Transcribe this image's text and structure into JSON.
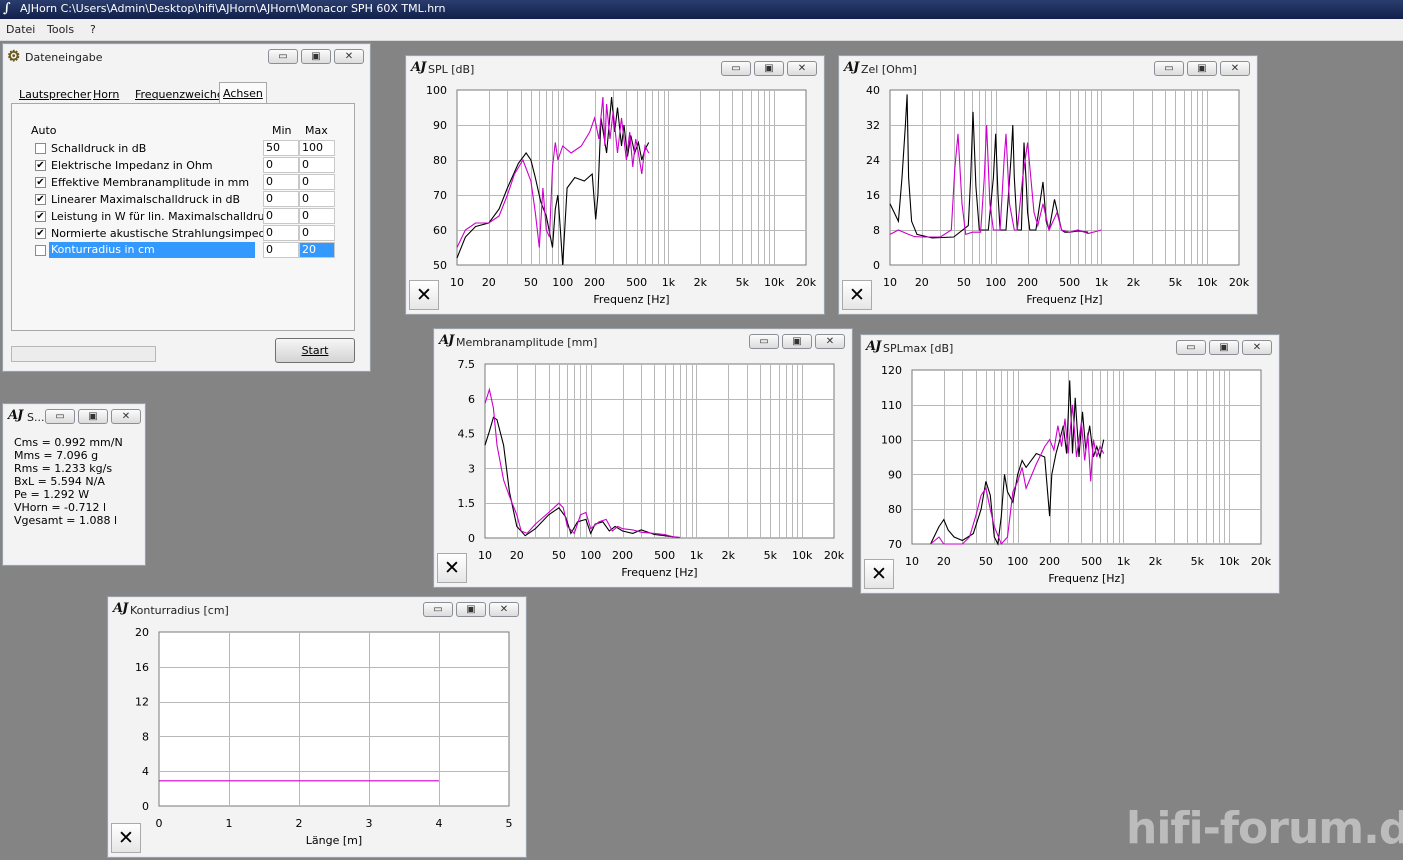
{
  "app": {
    "title": "AJHorn  C:\\Users\\Admin\\Desktop\\hifi\\AJHorn\\AJHorn\\Monacor SPH 60X TML.hrn"
  },
  "menu": [
    "Datei",
    "Tools",
    "?"
  ],
  "window_buttons": {
    "minimize": "▭",
    "restore": "▣",
    "close": "✕"
  },
  "x_button": "✕",
  "logo": "AJ",
  "data_input": {
    "title": "Dateneingabe",
    "tabs": [
      "Lautsprecher",
      "Horn",
      "Frequenzweiche",
      "Achsen"
    ],
    "active_tab": "Achsen",
    "headers": {
      "auto": "Auto",
      "min": "Min",
      "max": "Max"
    },
    "rows": [
      {
        "label": "Schalldruck in dB",
        "checked": false,
        "min": "50",
        "max": "100"
      },
      {
        "label": "Elektrische Impedanz in Ohm",
        "checked": true,
        "min": "0",
        "max": "0"
      },
      {
        "label": "Effektive Membranamplitude in mm",
        "checked": true,
        "min": "0",
        "max": "0"
      },
      {
        "label": "Linearer Maximalschalldruck in dB",
        "checked": true,
        "min": "0",
        "max": "0"
      },
      {
        "label": "Leistung in W für lin. Maximalschalldruck",
        "checked": true,
        "min": "0",
        "max": "0"
      },
      {
        "label": "Normierte akustische Strahlungsimpedanz",
        "checked": true,
        "min": "0",
        "max": "0"
      },
      {
        "label": "Konturradius in cm",
        "checked": false,
        "min": "0",
        "max": "20"
      }
    ],
    "start_label": "Start"
  },
  "params": {
    "title": "S...",
    "lines": [
      "Cms = 0.992 mm/N",
      "Mms = 7.096 g",
      "Rms = 1.233 kg/s",
      "BxL = 5.594 N/A",
      "Pe = 1.292 W",
      "VHorn = -0.712 l",
      "Vgesamt = 1.088 l"
    ]
  },
  "watermark": "hifi-forum.de",
  "colors": {
    "series_black": "#000000",
    "series_magenta": "#cc00cc",
    "desktop": "#848484",
    "selection": "#3399ff"
  },
  "chart_data": [
    {
      "id": "spl",
      "title": "SPL [dB]",
      "type": "line",
      "scale": "log",
      "xlabel": "Frequenz [Hz]",
      "ylim": [
        50,
        100
      ],
      "xlim": [
        10,
        20000
      ],
      "yticks": [
        "100",
        "90",
        "80",
        "70",
        "60",
        "50"
      ],
      "xticks": [
        {
          "v": 10,
          "t": "10"
        },
        {
          "v": 20,
          "t": "20"
        },
        {
          "v": 50,
          "t": "50"
        },
        {
          "v": 100,
          "t": "100"
        },
        {
          "v": 200,
          "t": "200"
        },
        {
          "v": 500,
          "t": "500"
        },
        {
          "v": 1000,
          "t": "1k"
        },
        {
          "v": 2000,
          "t": "2k"
        },
        {
          "v": 5000,
          "t": "5k"
        },
        {
          "v": 10000,
          "t": "10k"
        },
        {
          "v": 20000,
          "t": "20k"
        }
      ],
      "series": [
        {
          "color": "#000000",
          "x": [
            10,
            12,
            15,
            20,
            25,
            30,
            38,
            45,
            50,
            55,
            62,
            70,
            80,
            85,
            90,
            95,
            100,
            110,
            130,
            160,
            190,
            205,
            215,
            230,
            260,
            290,
            310,
            330,
            360,
            380,
            410,
            440,
            480,
            520,
            560,
            600,
            650
          ],
          "y": [
            52,
            58,
            61,
            62,
            66,
            72,
            79,
            82,
            80,
            75,
            68,
            64,
            55,
            66,
            70,
            60,
            50,
            72,
            75,
            74,
            76,
            63,
            70,
            92,
            82,
            98,
            88,
            95,
            84,
            90,
            81,
            87,
            82,
            85,
            80,
            83,
            85
          ]
        },
        {
          "color": "#cc00cc",
          "x": [
            10,
            12,
            15,
            20,
            25,
            30,
            35,
            42,
            50,
            55,
            60,
            65,
            70,
            75,
            80,
            85,
            90,
            100,
            120,
            150,
            180,
            200,
            220,
            240,
            250,
            260,
            280,
            300,
            330,
            360,
            400,
            430,
            460,
            490,
            520,
            560,
            600,
            650
          ],
          "y": [
            55,
            60,
            62,
            62,
            64,
            70,
            76,
            80,
            74,
            65,
            55,
            72,
            60,
            58,
            78,
            85,
            80,
            84,
            82,
            84,
            88,
            92,
            86,
            98,
            84,
            96,
            86,
            94,
            82,
            92,
            80,
            88,
            78,
            86,
            82,
            76,
            84,
            82
          ]
        }
      ]
    },
    {
      "id": "zel",
      "title": "Zel [Ohm]",
      "type": "line",
      "scale": "log",
      "xlabel": "Frequenz [Hz]",
      "ylim": [
        0,
        40
      ],
      "xlim": [
        10,
        20000
      ],
      "yticks": [
        "40",
        "32",
        "24",
        "16",
        "8",
        "0"
      ],
      "xticks": [
        {
          "v": 10,
          "t": "10"
        },
        {
          "v": 20,
          "t": "20"
        },
        {
          "v": 50,
          "t": "50"
        },
        {
          "v": 100,
          "t": "100"
        },
        {
          "v": 200,
          "t": "200"
        },
        {
          "v": 500,
          "t": "500"
        },
        {
          "v": 1000,
          "t": "1k"
        },
        {
          "v": 2000,
          "t": "2k"
        },
        {
          "v": 5000,
          "t": "5k"
        },
        {
          "v": 10000,
          "t": "10k"
        },
        {
          "v": 20000,
          "t": "20k"
        }
      ],
      "series": [
        {
          "color": "#000000",
          "x": [
            10,
            12,
            13,
            14,
            14.5,
            15,
            16,
            18,
            25,
            40,
            55,
            58,
            61,
            65,
            70,
            85,
            95,
            100,
            105,
            110,
            125,
            140,
            145,
            150,
            160,
            175,
            185,
            195,
            200,
            210,
            240,
            280,
            300,
            320,
            360,
            420,
            450,
            500,
            600,
            750
          ],
          "y": [
            14,
            10,
            20,
            32,
            39,
            20,
            10,
            7,
            6.2,
            6.4,
            9,
            20,
            35,
            18,
            8,
            8,
            20,
            30,
            16,
            8,
            8,
            25,
            32,
            20,
            8,
            8,
            28,
            18,
            12,
            8,
            8,
            19,
            10,
            8,
            15,
            8,
            7.5,
            7.5,
            7.8,
            7.5
          ]
        },
        {
          "color": "#cc00cc",
          "x": [
            10,
            12,
            15,
            17,
            20,
            30,
            38,
            41,
            44,
            48,
            52,
            60,
            72,
            78,
            82,
            88,
            95,
            110,
            120,
            125,
            135,
            150,
            160,
            180,
            200,
            230,
            250,
            280,
            320,
            380,
            420,
            500,
            600,
            750,
            1000
          ],
          "y": [
            7,
            8,
            7,
            6.5,
            6.4,
            6.4,
            8,
            22,
            30,
            14,
            7,
            7.5,
            7.5,
            20,
            32,
            14,
            8,
            8,
            24,
            30,
            14,
            8,
            8,
            20,
            28,
            12,
            9,
            14,
            8,
            12,
            8,
            7.5,
            8,
            7.2,
            8
          ]
        }
      ]
    },
    {
      "id": "membran",
      "title": "Membranamplitude [mm]",
      "type": "line",
      "scale": "log",
      "xlabel": "Frequenz [Hz]",
      "ylim": [
        0,
        7.5
      ],
      "xlim": [
        10,
        20000
      ],
      "yticks": [
        "7.5",
        "6",
        "4.5",
        "3",
        "1.5",
        "0"
      ],
      "xticks": [
        {
          "v": 10,
          "t": "10"
        },
        {
          "v": 20,
          "t": "20"
        },
        {
          "v": 50,
          "t": "50"
        },
        {
          "v": 100,
          "t": "100"
        },
        {
          "v": 200,
          "t": "200"
        },
        {
          "v": 500,
          "t": "500"
        },
        {
          "v": 1000,
          "t": "1k"
        },
        {
          "v": 2000,
          "t": "2k"
        },
        {
          "v": 5000,
          "t": "5k"
        },
        {
          "v": 10000,
          "t": "10k"
        },
        {
          "v": 20000,
          "t": "20k"
        }
      ],
      "series": [
        {
          "color": "#000000",
          "x": [
            10,
            11,
            12,
            13,
            15,
            17,
            20,
            24,
            30,
            40,
            50,
            58,
            65,
            75,
            90,
            100,
            110,
            130,
            150,
            170,
            200,
            250,
            300,
            400,
            500,
            600,
            700
          ],
          "y": [
            4.0,
            4.6,
            5.2,
            5.1,
            4.0,
            2.0,
            0.5,
            0.1,
            0.4,
            1.0,
            1.3,
            0.9,
            0.2,
            0.7,
            0.8,
            0.2,
            0.6,
            0.7,
            0.3,
            0.5,
            0.3,
            0.2,
            0.35,
            0.15,
            0.1,
            0.05,
            0.02
          ]
        },
        {
          "color": "#cc00cc",
          "x": [
            10,
            11,
            12,
            13,
            15,
            17,
            20,
            22,
            25,
            30,
            40,
            50,
            55,
            60,
            70,
            80,
            90,
            100,
            120,
            140,
            160,
            180,
            200,
            250,
            300,
            400,
            500,
            600,
            700
          ],
          "y": [
            5.8,
            6.4,
            5.6,
            4.0,
            2.5,
            1.8,
            1.0,
            0.3,
            0.2,
            0.6,
            1.1,
            1.5,
            1.3,
            0.5,
            0.2,
            1.0,
            1.1,
            0.4,
            0.7,
            0.8,
            0.3,
            0.5,
            0.4,
            0.35,
            0.25,
            0.2,
            0.15,
            0.05,
            0.02
          ]
        }
      ]
    },
    {
      "id": "splmax",
      "title": "SPLmax [dB]",
      "type": "line",
      "scale": "log",
      "xlabel": "Frequenz [Hz]",
      "ylim": [
        70,
        120
      ],
      "xlim": [
        10,
        20000
      ],
      "yticks": [
        "120",
        "110",
        "100",
        "90",
        "80",
        "70"
      ],
      "xticks": [
        {
          "v": 10,
          "t": "10"
        },
        {
          "v": 20,
          "t": "20"
        },
        {
          "v": 50,
          "t": "50"
        },
        {
          "v": 100,
          "t": "100"
        },
        {
          "v": 200,
          "t": "200"
        },
        {
          "v": 500,
          "t": "500"
        },
        {
          "v": 1000,
          "t": "1k"
        },
        {
          "v": 2000,
          "t": "2k"
        },
        {
          "v": 5000,
          "t": "5k"
        },
        {
          "v": 10000,
          "t": "10k"
        },
        {
          "v": 20000,
          "t": "20k"
        }
      ],
      "series": [
        {
          "color": "#000000",
          "x": [
            15,
            18,
            20,
            22,
            25,
            30,
            38,
            45,
            50,
            55,
            60,
            65,
            70,
            75,
            80,
            90,
            100,
            110,
            120,
            150,
            180,
            200,
            210,
            230,
            250,
            270,
            290,
            310,
            330,
            350,
            380,
            410,
            440,
            480,
            520,
            560,
            600,
            650
          ],
          "y": [
            70,
            75,
            77,
            74,
            72,
            71,
            73,
            80,
            88,
            84,
            72,
            68,
            78,
            90,
            85,
            82,
            90,
            94,
            92,
            96,
            95,
            78,
            90,
            96,
            100,
            104,
            96,
            117,
            96,
            112,
            95,
            108,
            97,
            104,
            95,
            98,
            95,
            100
          ]
        },
        {
          "color": "#cc00cc",
          "x": [
            15,
            18,
            20,
            25,
            30,
            35,
            40,
            45,
            50,
            55,
            60,
            70,
            80,
            90,
            100,
            110,
            120,
            150,
            180,
            200,
            220,
            240,
            260,
            280,
            300,
            330,
            360,
            400,
            430,
            460,
            490,
            520,
            560,
            600,
            650
          ],
          "y": [
            70,
            72,
            70,
            68,
            69,
            72,
            78,
            84,
            86,
            80,
            75,
            70,
            72,
            85,
            88,
            92,
            86,
            93,
            98,
            100,
            97,
            104,
            98,
            106,
            96,
            110,
            95,
            105,
            94,
            102,
            88,
            100,
            95,
            98,
            96
          ]
        }
      ]
    },
    {
      "id": "kontur",
      "title": "Konturradius [cm]",
      "type": "line",
      "scale": "linear",
      "xlabel": "Länge [m]",
      "ylim": [
        0,
        20
      ],
      "xlim": [
        0,
        5
      ],
      "yticks": [
        "20",
        "16",
        "12",
        "8",
        "4",
        "0"
      ],
      "xticks": [
        {
          "v": 0,
          "t": "0"
        },
        {
          "v": 1,
          "t": "1"
        },
        {
          "v": 2,
          "t": "2"
        },
        {
          "v": 3,
          "t": "3"
        },
        {
          "v": 4,
          "t": "4"
        },
        {
          "v": 5,
          "t": "5"
        }
      ],
      "series": [
        {
          "color": "#cc00cc",
          "x": [
            0,
            4
          ],
          "y": [
            2.9,
            2.9
          ]
        }
      ]
    }
  ]
}
